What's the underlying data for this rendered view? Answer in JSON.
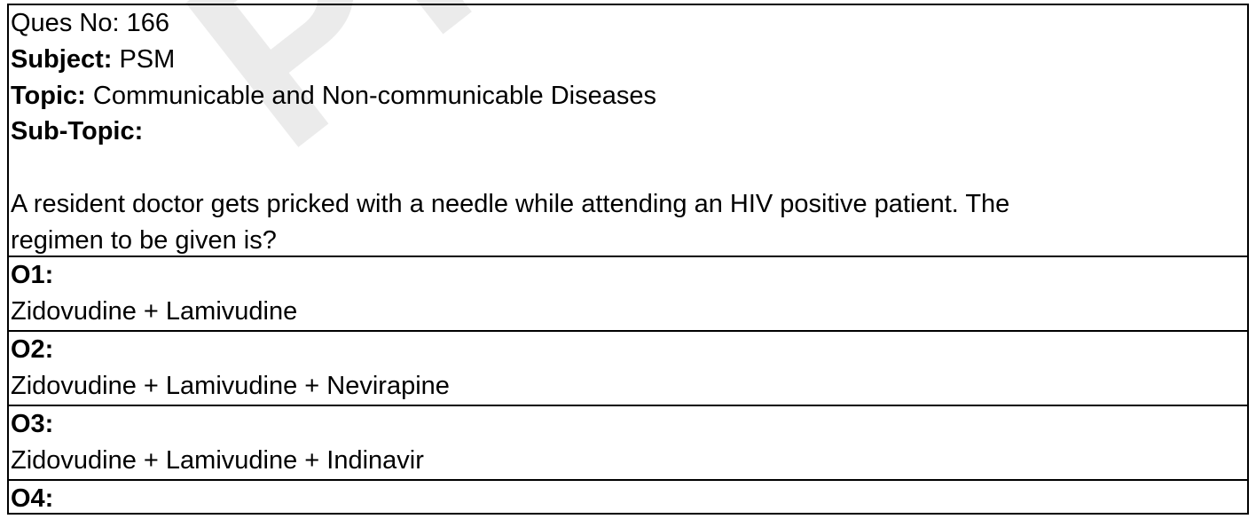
{
  "watermark": "Pro",
  "header": {
    "question_no_label": "Ques No:",
    "question_no": "166",
    "subject_label": "Subject:",
    "subject": "PSM",
    "topic_label": "Topic:",
    "topic": "Communicable and Non-communicable Diseases",
    "subtopic_label": "Sub-Topic:",
    "subtopic": ""
  },
  "question": {
    "line1": "A resident doctor gets pricked with a needle while attending an HIV positive patient. The",
    "line2": "regimen to be given is?"
  },
  "options": [
    {
      "label": "O1:",
      "text": "Zidovudine + Lamivudine"
    },
    {
      "label": "O2:",
      "text": "Zidovudine + Lamivudine + Nevirapine"
    },
    {
      "label": "O3:",
      "text": "Zidovudine + Lamivudine + Indinavir"
    },
    {
      "label": "O4:",
      "text": ""
    }
  ]
}
